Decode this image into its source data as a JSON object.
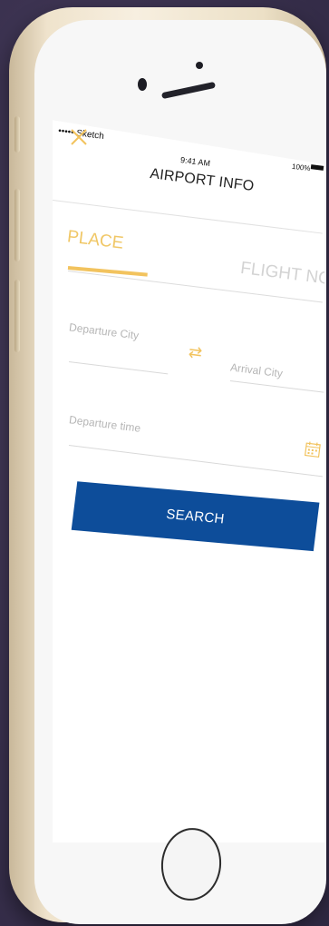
{
  "status_bar": {
    "carrier": "••••• Sketch",
    "time": "9:41 AM",
    "battery": "100%"
  },
  "header": {
    "title": "AIRPORT INFO",
    "close_icon": "close-icon"
  },
  "tabs": [
    {
      "label": "PLACE",
      "active": true
    },
    {
      "label": "FLIGHT NO",
      "active": false
    }
  ],
  "form": {
    "departure_city_placeholder": "Departure City",
    "arrival_city_placeholder": "Arrival City",
    "departure_time_placeholder": "Departure time",
    "swap_icon": "swap-icon",
    "calendar_icon": "calendar-icon"
  },
  "search_button": {
    "label": "SEARCH"
  },
  "colors": {
    "accent": "#f2c35e",
    "primary": "#0d4d9a",
    "placeholder": "#b5b5b5"
  }
}
